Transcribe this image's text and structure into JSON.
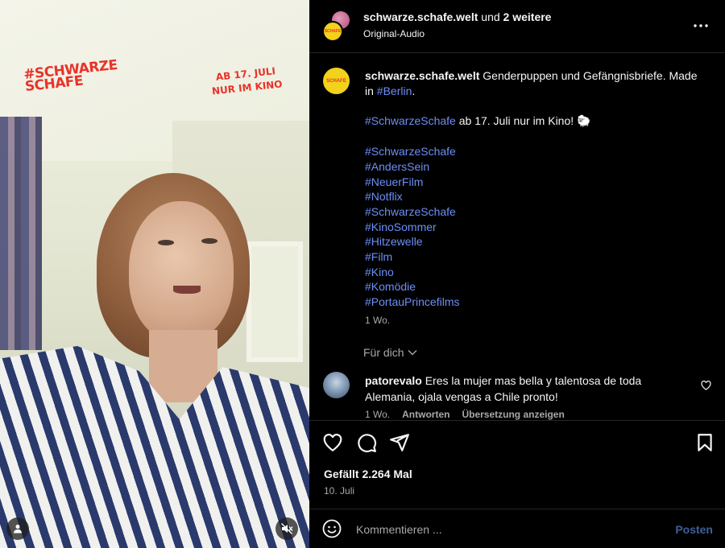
{
  "media": {
    "overlay_logo_lines": [
      "#SCHWARZE",
      "SCHAFE"
    ],
    "overlay_date_lines": [
      "AB 17. JULI",
      "NUR IM KINO"
    ],
    "user_button_icon": "user-icon",
    "mute_button_icon": "speaker-muted-icon"
  },
  "header": {
    "username": "schwarze.schafe.welt",
    "suffix_prefix": " und ",
    "suffix_count": "2 weitere",
    "audio_label": "Original-Audio",
    "more_icon": "more-horizontal-icon"
  },
  "caption": {
    "username": "schwarze.schafe.welt",
    "text": " Genderpuppen und Gefängnisbriefe. Made in ",
    "location_tag": "#Berlin",
    "text_end": ".",
    "line2_tag": "#SchwarzeSchafe",
    "line2_text": " ab 17. Juli nur im Kino! 🐑",
    "hashtags": [
      "#SchwarzeSchafe",
      "#AndersSein",
      "#NeuerFilm",
      "#Notflix",
      "#SchwarzeSchafe",
      "#KinoSommer",
      "#Hitzewelle",
      "#Film",
      "#Kino",
      "#Komödie",
      "#PortauPrincefilms"
    ],
    "time": "1 Wo."
  },
  "for_you": {
    "label": "Für dich"
  },
  "comment": {
    "username": "patorevalo",
    "text": " Eres la mujer mas bella y talentosa de toda Alemania, ojala vengas a Chile pronto!",
    "time": "1 Wo.",
    "reply_label": "Antworten",
    "translate_label": "Übersetzung anzeigen"
  },
  "actions": {
    "likes_label": "Gefällt 2.264 Mal",
    "date": "10. Juli"
  },
  "composer": {
    "placeholder": "Kommentieren ...",
    "post_label": "Posten"
  },
  "colors": {
    "background": "#000000",
    "hashtag": "#6d8ff5",
    "muted_text": "#a8a8a8",
    "post_button": "#3f5f9a",
    "brand_yellow": "#f2d21a",
    "brand_red": "#e8332a"
  }
}
